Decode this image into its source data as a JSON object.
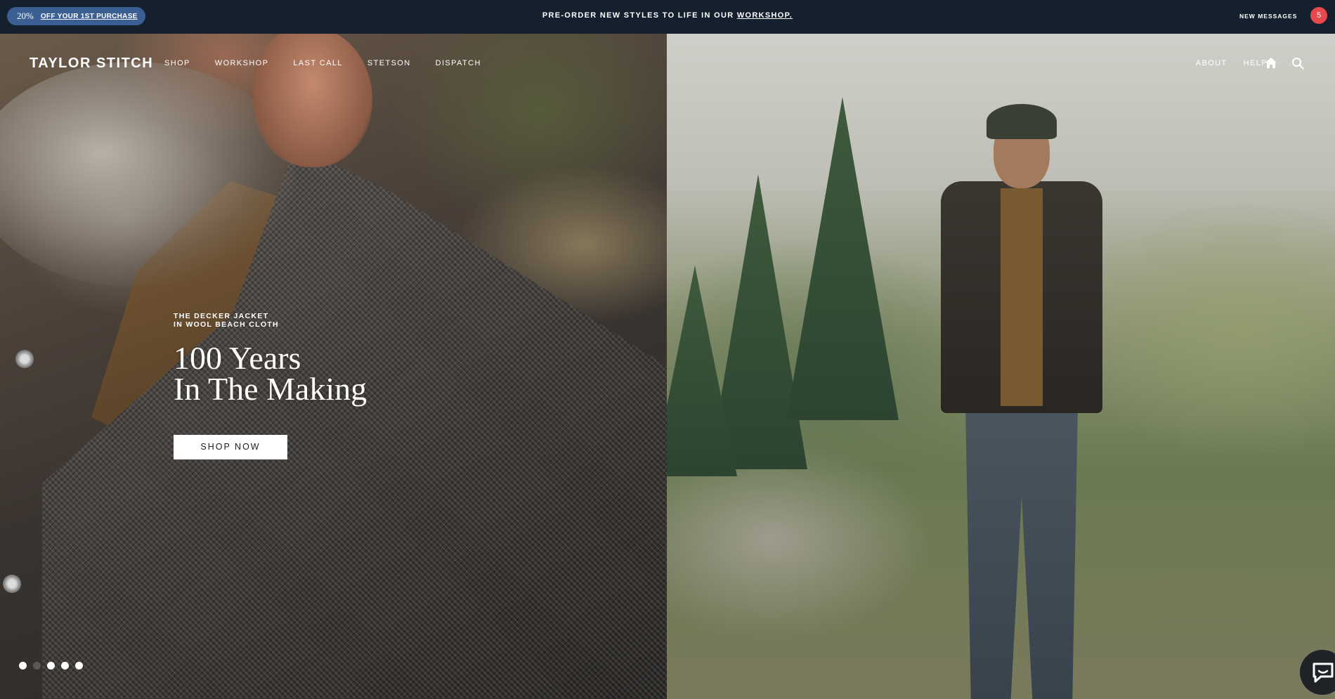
{
  "topbar": {
    "promo_percent": "20%",
    "promo_link": "OFF YOUR 1ST PURCHASE",
    "announcement_text": "PRE-ORDER NEW STYLES TO LIFE IN OUR ",
    "announcement_link": "WORKSHOP.",
    "messages_label": "NEW MESSAGES",
    "messages_count": "5",
    "background_color": "#14202e",
    "promo_color": "#3b5f93",
    "badge_color": "#e5484d"
  },
  "nav": {
    "logo": "TAYLOR STITCH",
    "left_links": [
      "SHOP",
      "WORKSHOP",
      "LAST CALL",
      "STETSON",
      "DISPATCH"
    ],
    "right_links": [
      "ABOUT",
      "HELP"
    ],
    "icons": [
      "home-icon",
      "search-icon"
    ]
  },
  "hero": {
    "eyebrow_line1": "THE DECKER JACKET",
    "eyebrow_line2": "IN WOOL BEACH CLOTH",
    "headline_line1": "100 Years",
    "headline_line2": "In The Making",
    "cta_label": "SHOP NOW"
  },
  "carousel": {
    "slide_count": 5,
    "active_states": [
      true,
      false,
      true,
      true,
      true
    ]
  },
  "chat": {
    "icon": "chat-bubble-icon"
  }
}
